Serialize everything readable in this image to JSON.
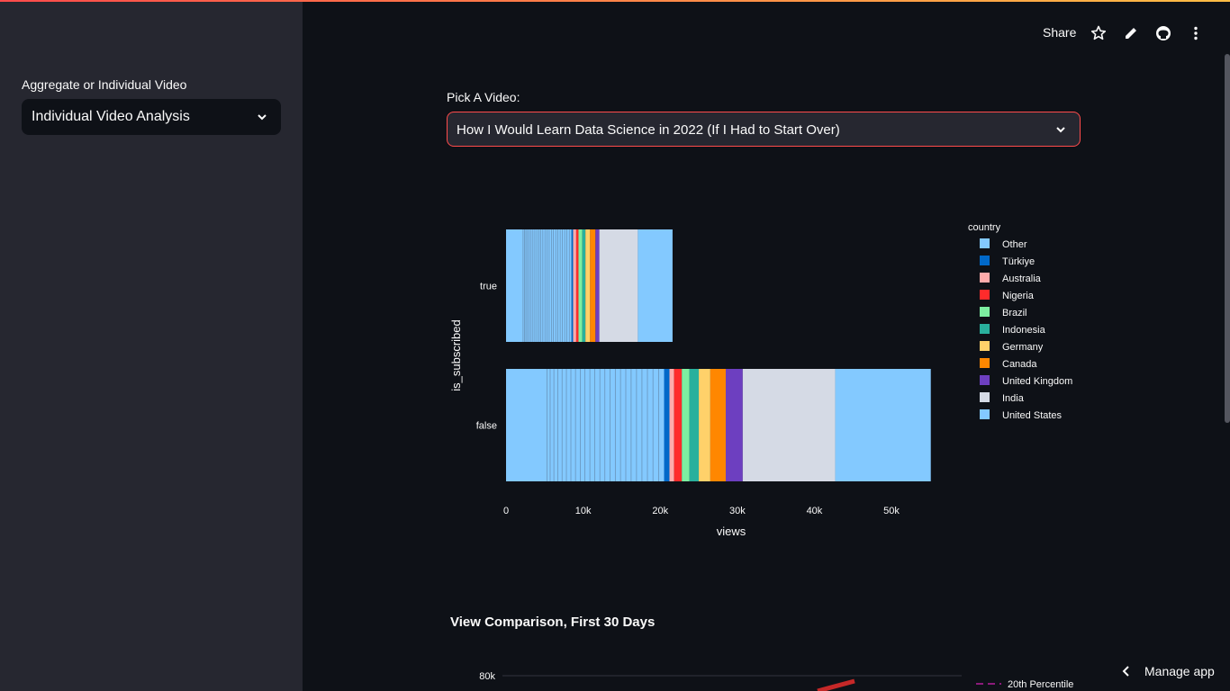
{
  "header": {
    "share_label": "Share",
    "icons": [
      "star-icon",
      "pencil-icon",
      "github-icon",
      "more-vertical-icon"
    ]
  },
  "sidebar": {
    "select_label": "Aggregate or Individual Video",
    "select_value": "Individual Video Analysis"
  },
  "main": {
    "pick_label": "Pick A Video:",
    "video_value": "How I Would Learn Data Science in 2022 (If I Had to Start Over)",
    "section_title": "View Comparison, First 30 Days"
  },
  "manage_label": "Manage app",
  "chart_data": [
    {
      "type": "bar",
      "orientation": "horizontal",
      "stacked": true,
      "xlabel": "views",
      "ylabel": "is_subscribed",
      "categories": [
        "false",
        "true"
      ],
      "xlim": [
        0,
        55600
      ],
      "xticks": [
        0,
        10000,
        20000,
        30000,
        40000,
        50000
      ],
      "xtick_labels": [
        "0",
        "10k",
        "20k",
        "30k",
        "40k",
        "50k"
      ],
      "legend_title": "country",
      "legend_position": "right",
      "series": [
        {
          "name": "Other",
          "color": "#83c9ff",
          "values": [
            20500,
            8500
          ]
        },
        {
          "name": "Türkiye",
          "color": "#0068c9",
          "values": [
            700,
            200
          ]
        },
        {
          "name": "Australia",
          "color": "#ffabab",
          "values": [
            600,
            400
          ]
        },
        {
          "name": "Nigeria",
          "color": "#ff2b2b",
          "values": [
            1000,
            300
          ]
        },
        {
          "name": "Brazil",
          "color": "#7defa1",
          "values": [
            1000,
            500
          ]
        },
        {
          "name": "Indonesia",
          "color": "#29b09d",
          "values": [
            1200,
            400
          ]
        },
        {
          "name": "Germany",
          "color": "#ffd16a",
          "values": [
            1500,
            600
          ]
        },
        {
          "name": "Canada",
          "color": "#ff8700",
          "values": [
            2000,
            700
          ]
        },
        {
          "name": "United Kingdom",
          "color": "#6d3fc0",
          "values": [
            2200,
            500
          ]
        },
        {
          "name": "India",
          "color": "#d5dae5",
          "values": [
            12000,
            5000
          ]
        },
        {
          "name": "United States",
          "color": "#83c9ff",
          "values": [
            12400,
            4500
          ]
        }
      ],
      "segment_line_color": "#4a5568"
    },
    {
      "type": "line",
      "title": "View Comparison, First 30 Days",
      "ytick_labels": [
        "80k"
      ],
      "yticks": [
        80000
      ],
      "series": [
        {
          "name": "20th Percentile",
          "color": "#8b1a7a",
          "style": "dashed"
        },
        {
          "name": "",
          "color": "#c62828",
          "style": "solid"
        }
      ]
    }
  ]
}
